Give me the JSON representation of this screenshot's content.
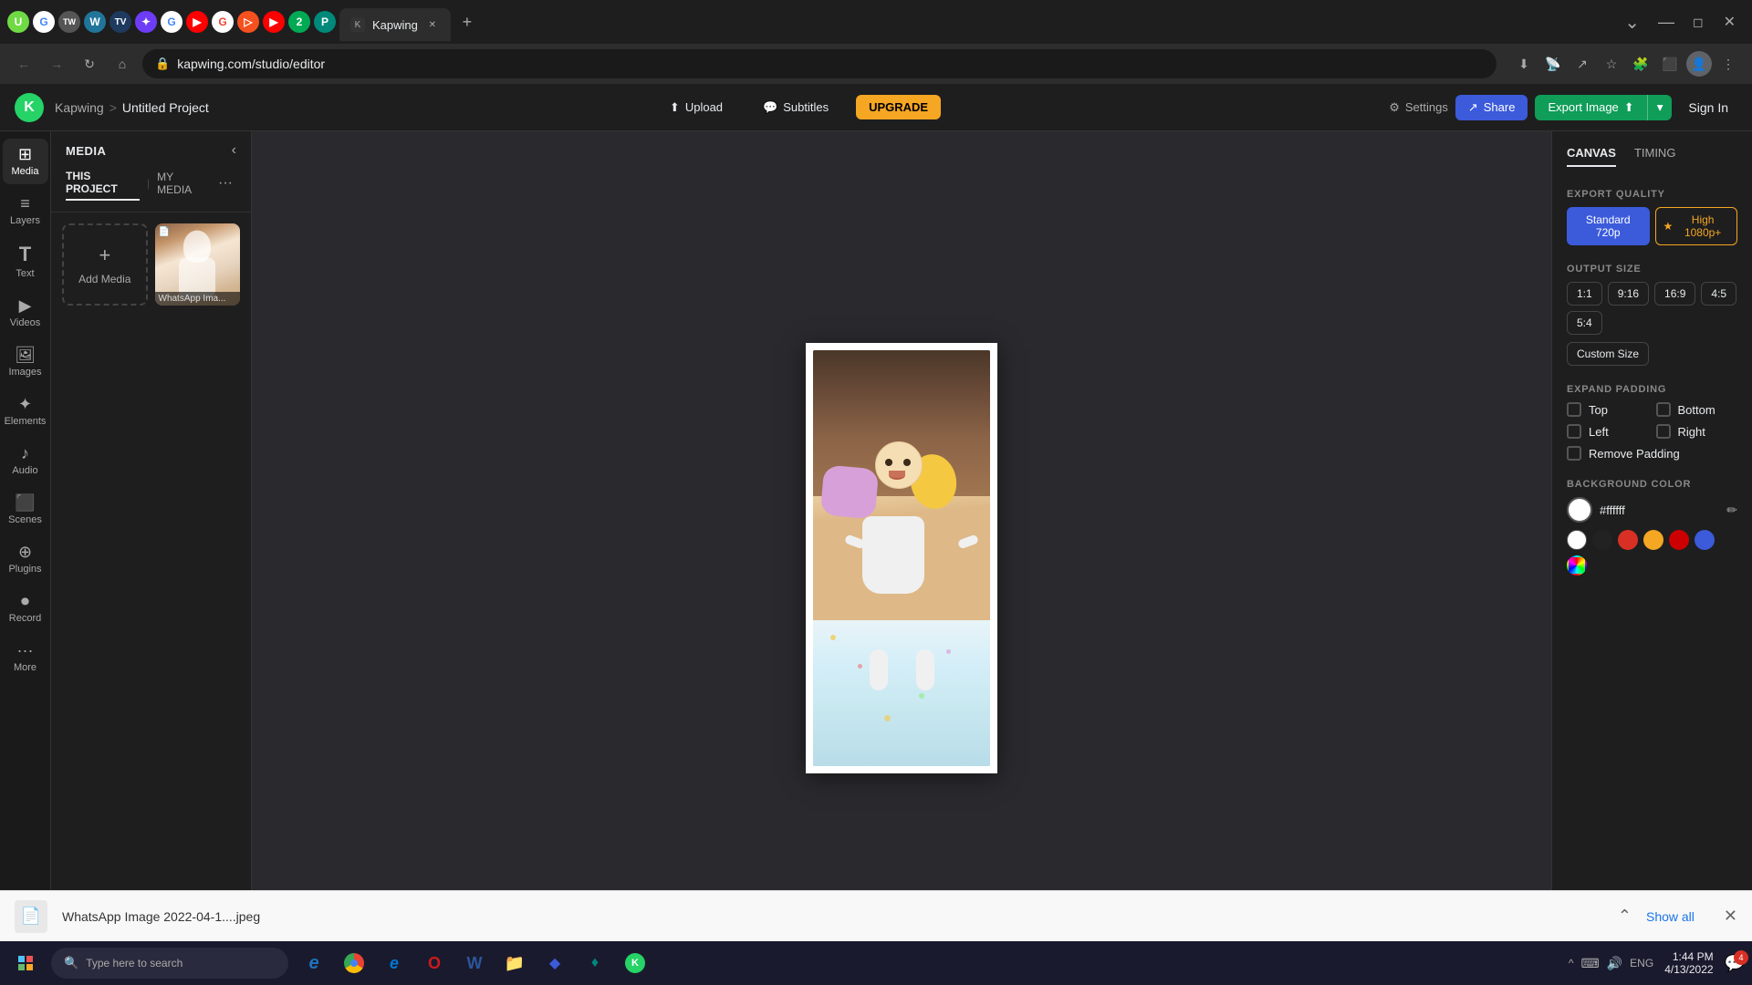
{
  "browser": {
    "url": "kapwing.com/studio/editor",
    "active_tab_label": "K",
    "tabs": [
      {
        "id": "upwork",
        "icon": "U",
        "color": "#6fda44",
        "bg": "#fff"
      },
      {
        "id": "google1",
        "icon": "G",
        "color": "#4285f4",
        "bg": "#fff"
      },
      {
        "id": "tw",
        "icon": "TW",
        "color": "#fff",
        "bg": "#333"
      },
      {
        "id": "wordpress",
        "icon": "W",
        "color": "#fff",
        "bg": "#21759b"
      },
      {
        "id": "tv",
        "icon": "T",
        "color": "#fff",
        "bg": "#1e3a5f"
      },
      {
        "id": "filmora",
        "icon": "F",
        "color": "#fff",
        "bg": "#6c3cf7"
      },
      {
        "id": "google2",
        "icon": "G",
        "color": "#4285f4",
        "bg": "#fff"
      },
      {
        "id": "youtube1",
        "icon": "▶",
        "color": "#fff",
        "bg": "#ff0000"
      },
      {
        "id": "google3",
        "icon": "G",
        "color": "#ea4335",
        "bg": "#fff"
      },
      {
        "id": "git",
        "icon": "▷",
        "color": "#fff",
        "bg": "#f4511e"
      },
      {
        "id": "youtube2",
        "icon": "▶",
        "color": "#fff",
        "bg": "#ff0000"
      },
      {
        "id": "z2",
        "icon": "2",
        "color": "#fff",
        "bg": "#00aa55"
      },
      {
        "id": "pict",
        "icon": "P",
        "color": "#fff",
        "bg": "#00897b"
      }
    ],
    "active_tab_id": "kapwing"
  },
  "app": {
    "logo_text": "K",
    "brand": "Kapwing",
    "breadcrumb_sep": ">",
    "project_name": "Untitled Project",
    "header": {
      "upload_label": "Upload",
      "subtitles_label": "Subtitles",
      "upgrade_label": "UPGRADE",
      "settings_label": "Settings",
      "share_label": "Share",
      "export_label": "Export Image",
      "sign_in_label": "Sign In"
    }
  },
  "sidebar": {
    "items": [
      {
        "id": "media",
        "icon": "⊞",
        "label": "Media"
      },
      {
        "id": "layers",
        "icon": "≡",
        "label": "Layers"
      },
      {
        "id": "text",
        "icon": "T",
        "label": "Text"
      },
      {
        "id": "videos",
        "icon": "▶",
        "label": "Videos"
      },
      {
        "id": "images",
        "icon": "🖼",
        "label": "Images"
      },
      {
        "id": "elements",
        "icon": "✦",
        "label": "Elements"
      },
      {
        "id": "audio",
        "icon": "♪",
        "label": "Audio"
      },
      {
        "id": "scenes",
        "icon": "⬛",
        "label": "Scenes"
      },
      {
        "id": "plugins",
        "icon": "⊕",
        "label": "Plugins"
      },
      {
        "id": "record",
        "icon": "⏺",
        "label": "Record"
      },
      {
        "id": "more",
        "icon": "•••",
        "label": "More"
      }
    ]
  },
  "media_panel": {
    "title": "MEDIA",
    "tabs": [
      {
        "id": "this_project",
        "label": "THIS PROJECT"
      },
      {
        "id": "my_media",
        "label": "MY MEDIA"
      }
    ],
    "add_media_label": "Add Media",
    "media_items": [
      {
        "id": "whatsapp_img",
        "label": "WhatsApp Ima...",
        "has_icon": true
      }
    ]
  },
  "right_panel": {
    "tabs": [
      {
        "id": "canvas",
        "label": "CANVAS"
      },
      {
        "id": "timing",
        "label": "TIMING"
      }
    ],
    "export_quality": {
      "label": "EXPORT QUALITY",
      "options": [
        {
          "id": "720p",
          "label": "Standard 720p",
          "active": true
        },
        {
          "id": "1080p",
          "label": "★ High 1080p+",
          "premium": true
        }
      ]
    },
    "output_size": {
      "label": "OUTPUT SIZE",
      "options": [
        {
          "id": "1_1",
          "label": "1:1"
        },
        {
          "id": "9_16",
          "label": "9:16"
        },
        {
          "id": "16_9",
          "label": "16:9"
        },
        {
          "id": "4_5",
          "label": "4:5"
        },
        {
          "id": "5_4",
          "label": "5:4"
        }
      ],
      "custom_size_label": "Custom Size"
    },
    "expand_padding": {
      "label": "EXPAND PADDING",
      "items": [
        {
          "id": "top",
          "label": "Top",
          "checked": false
        },
        {
          "id": "bottom",
          "label": "Bottom",
          "checked": false
        },
        {
          "id": "left",
          "label": "Left",
          "checked": false
        },
        {
          "id": "right",
          "label": "Right",
          "checked": false
        }
      ],
      "remove_padding_label": "Remove Padding"
    },
    "background_color": {
      "label": "BACKGROUND COLOR",
      "current_hex": "#ffffff",
      "presets": [
        {
          "color": "#ffffff",
          "id": "white"
        },
        {
          "color": "#000000",
          "id": "black"
        },
        {
          "color": "#d93025",
          "id": "red"
        },
        {
          "color": "#f5a623",
          "id": "orange"
        },
        {
          "color": "#d93025",
          "id": "red2"
        },
        {
          "color": "#3b5bdb",
          "id": "blue"
        },
        {
          "color": "conic-gradient(red, yellow, lime, cyan, blue, magenta, red)",
          "id": "rainbow"
        }
      ]
    }
  },
  "bottom_bar": {
    "filename": "WhatsApp Image 2022-04-1....jpeg",
    "show_all_label": "Show all"
  },
  "taskbar": {
    "search_placeholder": "Type here to search",
    "apps": [
      {
        "id": "ie",
        "icon": "e",
        "color": "#1e73be"
      },
      {
        "id": "chrome",
        "icon": "●",
        "color": "#4caf50"
      },
      {
        "id": "edge",
        "icon": "e",
        "color": "#0078d4"
      },
      {
        "id": "opera",
        "icon": "O",
        "color": "#cc1b1b"
      },
      {
        "id": "word",
        "icon": "W",
        "color": "#2b579a"
      },
      {
        "id": "explorer",
        "icon": "📁",
        "color": "#f9c74f"
      },
      {
        "id": "app1",
        "icon": "◆",
        "color": "#3b5bdb"
      },
      {
        "id": "app2",
        "icon": "♦",
        "color": "#00897b"
      },
      {
        "id": "kapwing_task",
        "icon": "K",
        "color": "#25d366"
      }
    ],
    "time": "1:44 PM",
    "date": "4/13/2022",
    "lang": "ENG",
    "notification_count": "4"
  }
}
